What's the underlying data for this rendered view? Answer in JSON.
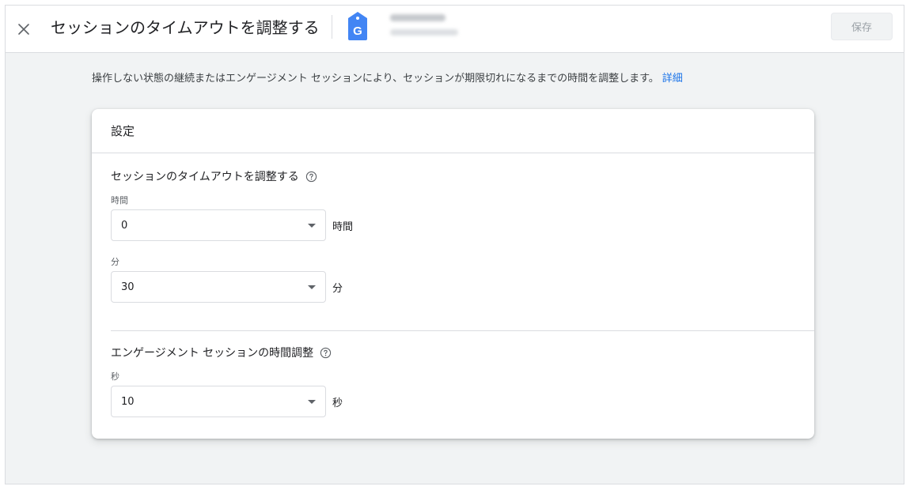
{
  "header": {
    "title": "セッションのタイムアウトを調整する",
    "property_name": "",
    "property_id": "",
    "save_label": "保存"
  },
  "description": {
    "text": "操作しない状態の継続またはエンゲージメント セッションにより、セッションが期限切れになるまでの時間を調整します。",
    "link": "詳細"
  },
  "card": {
    "title": "設定",
    "timeout": {
      "title": "セッションのタイムアウトを調整する",
      "hours": {
        "label": "時間",
        "value": "0",
        "unit": "時間"
      },
      "minutes": {
        "label": "分",
        "value": "30",
        "unit": "分"
      }
    },
    "engaged": {
      "title": "エンゲージメント セッションの時間調整",
      "seconds": {
        "label": "秒",
        "value": "10",
        "unit": "秒"
      }
    }
  },
  "colors": {
    "accent": "#1a73e8",
    "background": "#f1f3f4",
    "border": "#dadce0"
  },
  "icons": {
    "close": "close-icon",
    "tag": "google-tag-icon",
    "help": "help-icon",
    "dropdown": "caret-down-icon"
  }
}
